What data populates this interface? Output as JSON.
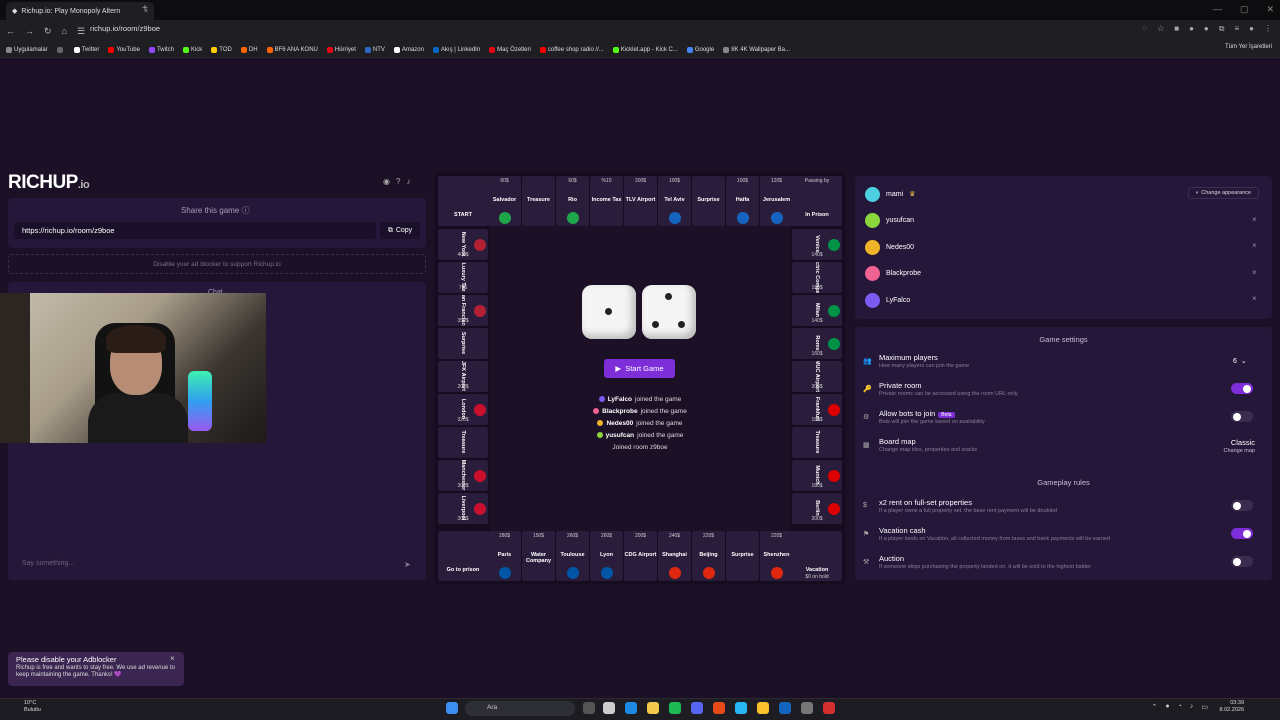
{
  "browser": {
    "tab_title": "Richup.io: Play Monopoly Altern",
    "tab_close": "×",
    "new_tab": "+",
    "url": "richup.io/room/z9boe",
    "all_bookmarks": "Tüm Yer İşaretleri",
    "bookmarks": [
      {
        "label": "Uygulamalar",
        "color": "#888888"
      },
      {
        "label": "",
        "color": "#666666"
      },
      {
        "label": "Twitter",
        "color": "#ffffff"
      },
      {
        "label": "YouTube",
        "color": "#ff0000"
      },
      {
        "label": "Twitch",
        "color": "#9146ff"
      },
      {
        "label": "Kick",
        "color": "#53fc18"
      },
      {
        "label": "TOD",
        "color": "#ffcc00"
      },
      {
        "label": "DH",
        "color": "#ff6600"
      },
      {
        "label": "BF6 ANA KONU",
        "color": "#ff6600"
      },
      {
        "label": "Hürriyet",
        "color": "#e30613"
      },
      {
        "label": "NTV",
        "color": "#3366cc"
      },
      {
        "label": "Amazon",
        "color": "#ffffff"
      },
      {
        "label": "Akış | LinkedIn",
        "color": "#0a66c2"
      },
      {
        "label": "Maç Özetleri",
        "color": "#e30613"
      },
      {
        "label": "coffee shop radio //...",
        "color": "#ff0000"
      },
      {
        "label": "Kicklet.app - Kick C...",
        "color": "#53fc18"
      },
      {
        "label": "Google",
        "color": "#4285f4"
      },
      {
        "label": "8K 4K Wallpaper Ba...",
        "color": "#888888"
      }
    ]
  },
  "left": {
    "logo": "RICHUP",
    "logo_suffix": ".io",
    "share_title": "Share this game",
    "share_url": "https://richup.io/room/z9boe",
    "copy_label": "Copy",
    "ad_text": "Disable your ad blocker to support Richup.io",
    "chat_title": "Chat",
    "chat_placeholder": "Say something..."
  },
  "board": {
    "top": [
      {
        "name": "Salvador",
        "price": "60$",
        "flag": "#1fa64a"
      },
      {
        "name": "Treasure",
        "price": "",
        "flag": ""
      },
      {
        "name": "Rio",
        "price": "60$",
        "flag": "#1fa64a"
      },
      {
        "name": "Income Tax",
        "price": "%10",
        "flag": ""
      },
      {
        "name": "TLV Airport",
        "price": "200$",
        "flag": ""
      },
      {
        "name": "Tel Aviv",
        "price": "100$",
        "flag": "#1565c0"
      },
      {
        "name": "Surprise",
        "price": "",
        "flag": ""
      },
      {
        "name": "Haifa",
        "price": "100$",
        "flag": "#1565c0"
      },
      {
        "name": "Jerusalem",
        "price": "120$",
        "flag": "#1565c0"
      }
    ],
    "bottom": [
      {
        "name": "Liverpool",
        "price": "280$",
        "flag": "#c8102e"
      },
      {
        "name": "Paris",
        "price": "280$",
        "flag": "#0055a4"
      },
      {
        "name": "Water Company",
        "price": "150$",
        "flag": ""
      },
      {
        "name": "Toulouse",
        "price": "260$",
        "flag": "#0055a4"
      },
      {
        "name": "Lyon",
        "price": "260$",
        "flag": "#0055a4"
      },
      {
        "name": "CDG Airport",
        "price": "200$",
        "flag": ""
      },
      {
        "name": "Shanghai",
        "price": "240$",
        "flag": "#de2910"
      },
      {
        "name": "Beijing",
        "price": "220$",
        "flag": "#de2910"
      },
      {
        "name": "Surprise",
        "price": "",
        "flag": ""
      },
      {
        "name": "Shenzhen",
        "price": "220$",
        "flag": "#de2910"
      }
    ],
    "left": [
      {
        "name": "New York",
        "price": "400$",
        "flag": "#b22234"
      },
      {
        "name": "Luxury Tax",
        "price": "75$",
        "flag": ""
      },
      {
        "name": "San Francisco",
        "price": "350$",
        "flag": "#b22234"
      },
      {
        "name": "Surprise",
        "price": "",
        "flag": ""
      },
      {
        "name": "JFK Airport",
        "price": "200$",
        "flag": ""
      },
      {
        "name": "London",
        "price": "320$",
        "flag": "#c8102e"
      },
      {
        "name": "Treasure",
        "price": "",
        "flag": ""
      },
      {
        "name": "Manchester",
        "price": "300$",
        "flag": "#c8102e"
      },
      {
        "name": "Liverpool",
        "price": "300$",
        "flag": "#c8102e"
      }
    ],
    "right": [
      {
        "name": "Venice",
        "price": "140$",
        "flag": "#009246"
      },
      {
        "name": "Electric Company",
        "price": "150$",
        "flag": ""
      },
      {
        "name": "Milan",
        "price": "140$",
        "flag": "#009246"
      },
      {
        "name": "Rome",
        "price": "160$",
        "flag": "#009246"
      },
      {
        "name": "MUC Airport",
        "price": "200$",
        "flag": ""
      },
      {
        "name": "Frankfurt",
        "price": "180$",
        "flag": "#dd0000"
      },
      {
        "name": "Treasure",
        "price": "",
        "flag": ""
      },
      {
        "name": "Munich",
        "price": "180$",
        "flag": "#dd0000"
      },
      {
        "name": "Berlin",
        "price": "200$",
        "flag": "#dd0000"
      }
    ],
    "corners": {
      "start": "START",
      "prison_top": "Passing by",
      "prison": "In Prison",
      "go_to_prison": "Go to prison",
      "vacation": "Vacation",
      "vacation_sub": "$0 on hold"
    },
    "start_button": "Start Game",
    "log": [
      {
        "name": "LyFalco",
        "text": "joined the game",
        "color": "#7c5cf0"
      },
      {
        "name": "Blackprobe",
        "text": "joined the game",
        "color": "#f06292"
      },
      {
        "name": "Nedes00",
        "text": "joined the game",
        "color": "#f0b429"
      },
      {
        "name": "yusufcan",
        "text": "joined the game",
        "color": "#8bd63c"
      }
    ],
    "room_text": "Joined room z9boe"
  },
  "players": [
    {
      "name": "mami",
      "color": "#4dd0e1",
      "crown": "♛"
    },
    {
      "name": "yusufcan",
      "color": "#8bd63c",
      "crown": ""
    },
    {
      "name": "Nedes00",
      "color": "#f0b429",
      "crown": ""
    },
    {
      "name": "Blackprobe",
      "color": "#f06292",
      "crown": ""
    },
    {
      "name": "LyFalco",
      "color": "#7c5cf0",
      "crown": ""
    }
  ],
  "change_appearance": "Change appearance",
  "settings": {
    "title": "Game settings",
    "max_players": {
      "title": "Maximum players",
      "desc": "How many players can join the game",
      "value": "6"
    },
    "private_room": {
      "title": "Private room",
      "desc": "Private rooms can be accessed using the room URL only"
    },
    "allow_bots": {
      "title": "Allow bots to join",
      "badge": "Beta",
      "desc": "Bots will join the game based on availability"
    },
    "board_map": {
      "title": "Board map",
      "desc": "Change map tiles, properties and stacks",
      "value": "Classic",
      "link": "Change map"
    },
    "rules_title": "Gameplay rules",
    "x2_rent": {
      "title": "x2 rent on full-set properties",
      "desc": "If a player owns a full property set, the base rent payment will be doubled"
    },
    "vacation_cash": {
      "title": "Vacation cash",
      "desc": "If a player lands on Vacation, all collected money from taxes and bank payments will be earned"
    },
    "auction": {
      "title": "Auction",
      "desc": "If someone skips purchasing the property landed on, it will be sold to the highest bidder"
    }
  },
  "toast": {
    "title": "Please disable your Adblocker",
    "body": "Richup is free and wants to stay free. We use ad revenue to keep maintaining the game. Thanks! 💜"
  },
  "taskbar": {
    "weather_temp": "10°C",
    "weather_desc": "Bulutlu",
    "search": "Ara",
    "time": "03:39",
    "date": "8.02.2026"
  }
}
